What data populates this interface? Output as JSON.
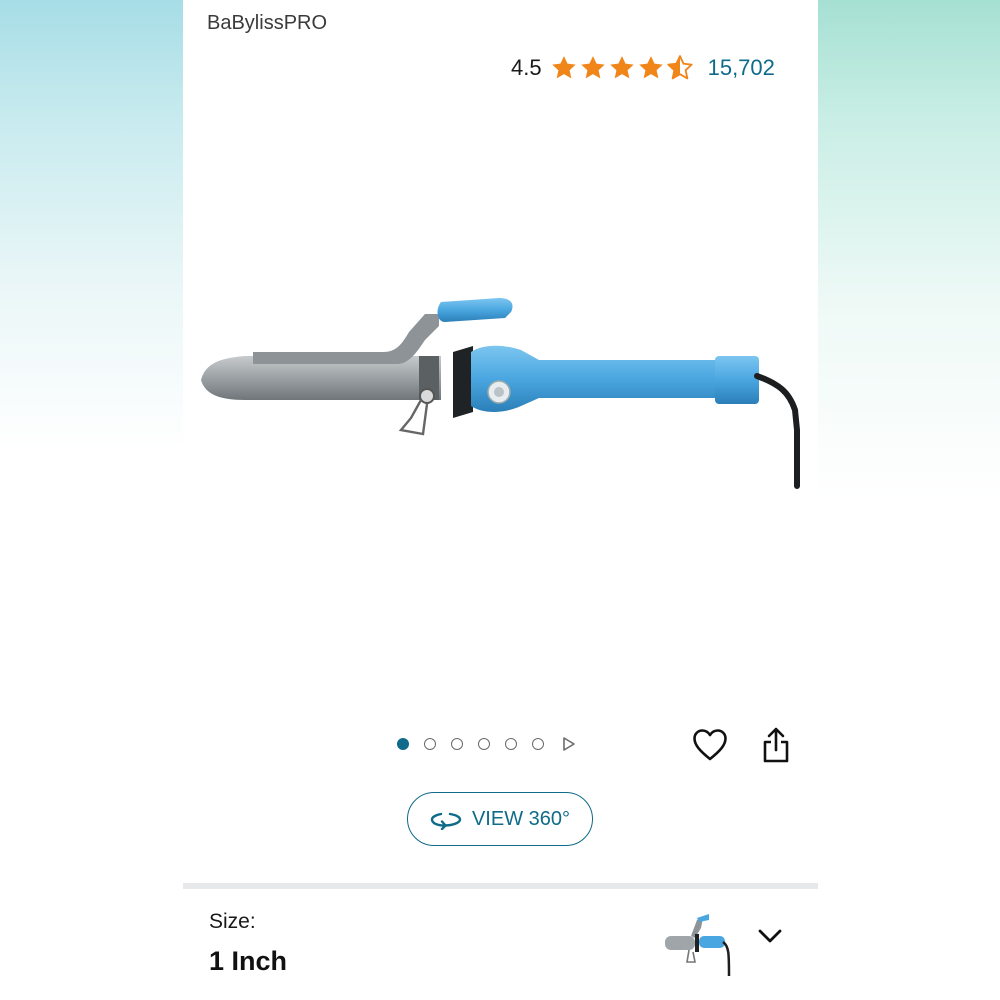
{
  "product": {
    "brand": "BaBylissPRO",
    "rating_value": "4.5",
    "rating_stars": 4.5,
    "review_count": "15,702"
  },
  "gallery": {
    "total_images": 6,
    "active_index": 0
  },
  "actions": {
    "view360_label": "VIEW 360°"
  },
  "size": {
    "label": "Size:",
    "value": "1 Inch"
  },
  "icons": {
    "wishlist": "heart-icon",
    "share": "share-icon",
    "rotate": "rotate-360-icon",
    "dropdown": "chevron-down-icon",
    "next": "play-triangle-icon"
  },
  "colors": {
    "star": "#f0861a",
    "link": "#0f6b89",
    "barrel_blue": "#4aa6e0"
  }
}
